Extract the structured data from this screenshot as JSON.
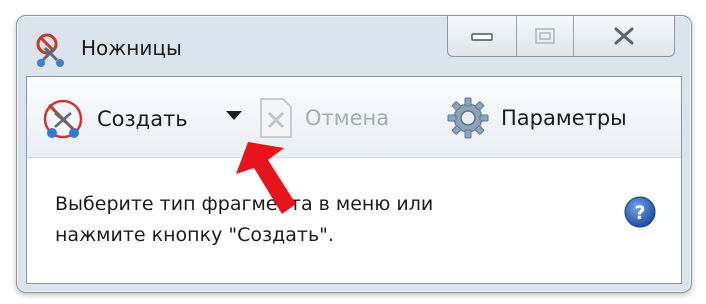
{
  "window": {
    "title": "Ножницы",
    "controls": {
      "minimize": "minimize",
      "maximize": "maximize",
      "close": "close"
    }
  },
  "toolbar": {
    "new_label": "Создать",
    "cancel_label": "Отмена",
    "options_label": "Параметры"
  },
  "message": {
    "line1": "Выберите тип фрагмента в меню или",
    "line2": "нажмите кнопку \"Создать\"."
  },
  "colors": {
    "annotation_arrow": "#e8141b",
    "help_icon": "#1f5fbf"
  },
  "icons": [
    "scissors-icon",
    "new-snip-icon",
    "dropdown-arrow-icon",
    "cancel-icon",
    "gear-icon",
    "help-icon",
    "minimize-icon",
    "maximize-icon",
    "close-icon"
  ]
}
